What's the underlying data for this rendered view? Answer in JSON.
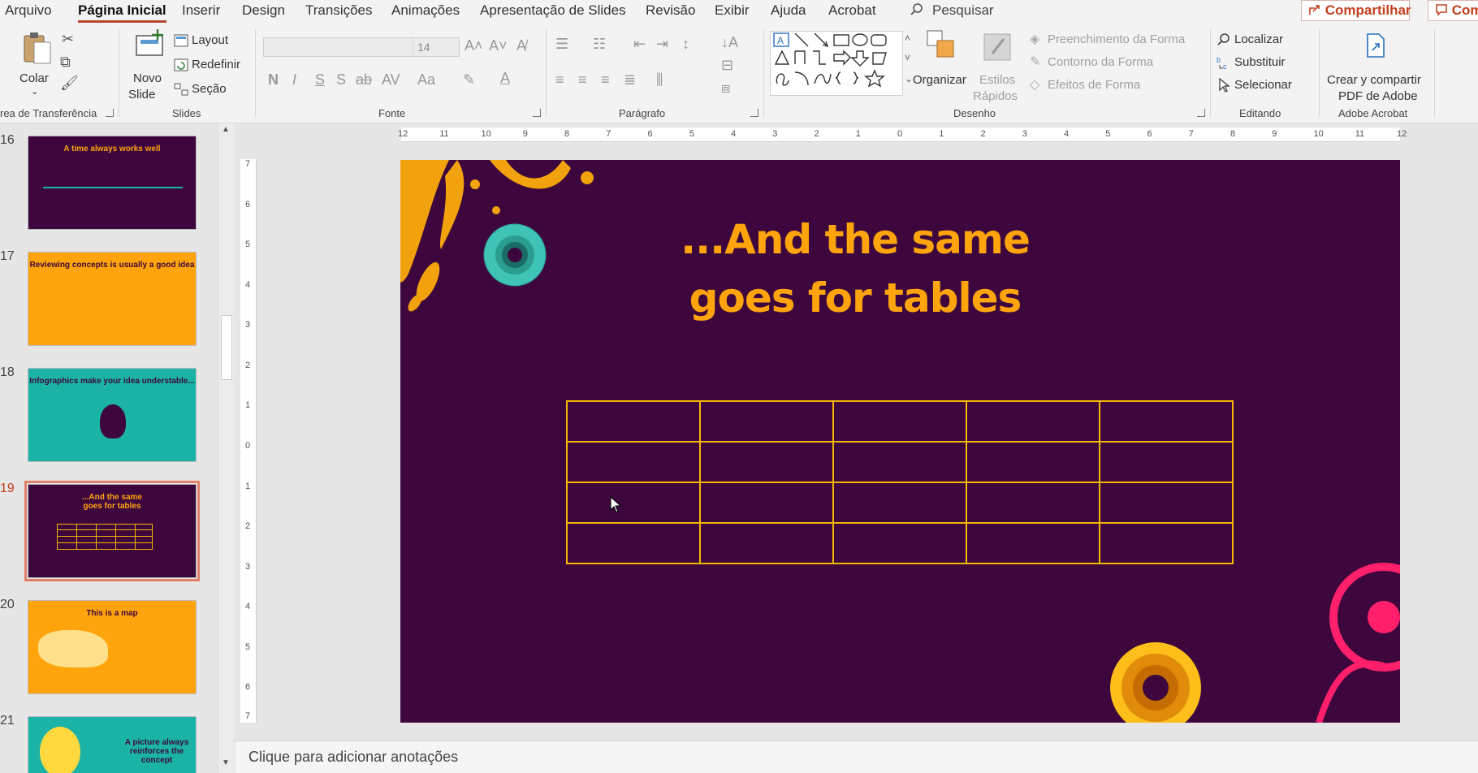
{
  "menu": {
    "tabs": [
      "Arquivo",
      "Página Inicial",
      "Inserir",
      "Design",
      "Transições",
      "Animações",
      "Apresentação de Slides",
      "Revisão",
      "Exibir",
      "Ajuda",
      "Acrobat"
    ],
    "active_tab": "Página Inicial",
    "search_label": "Pesquisar",
    "share_label": "Compartilhar",
    "comments_label": "Com"
  },
  "ribbon": {
    "clipboard": {
      "paste": "Colar",
      "label": "rea de Transferência"
    },
    "slides": {
      "new_slide_1": "Novo",
      "new_slide_2": "Slide",
      "layout": "Layout",
      "reset": "Redefinir",
      "section": "Seção",
      "label": "Slides"
    },
    "font": {
      "font_name": "",
      "font_size": "14",
      "label": "Fonte"
    },
    "paragraph": {
      "label": "Parágrafo"
    },
    "drawing": {
      "arrange": "Organizar",
      "quick_styles_1": "Estilos",
      "quick_styles_2": "Rápidos",
      "shape_fill": "Preenchimento da Forma",
      "shape_outline": "Contorno da Forma",
      "shape_effects": "Efeitos de Forma",
      "label": "Desenho"
    },
    "editing": {
      "find": "Localizar",
      "replace": "Substituir",
      "select": "Selecionar",
      "label": "Editando"
    },
    "acrobat": {
      "create_share_1": "Crear y compartir",
      "create_share_2": "PDF de Adobe",
      "label": "Adobe Acrobat"
    }
  },
  "thumbnails": [
    {
      "num": "16",
      "title": "A time always works well",
      "bg": "#3d073d",
      "fg": "#ffa40d"
    },
    {
      "num": "17",
      "title": "Reviewing concepts is usually a good idea",
      "bg": "#ffa40d",
      "fg": "#3d073d"
    },
    {
      "num": "18",
      "title": "Infographics make your idea understable...",
      "bg": "#1ab3a6",
      "fg": "#3d073d"
    },
    {
      "num": "19",
      "title": "...And the same goes for tables",
      "bg": "#3d073d",
      "fg": "#ffa40d"
    },
    {
      "num": "20",
      "title": "This is a map",
      "bg": "#ffa40d",
      "fg": "#3d073d"
    },
    {
      "num": "21",
      "title": "A picture always reinforces the concept",
      "bg": "#1ab3a6",
      "fg": "#3d073d"
    }
  ],
  "selected_thumbnail": "19",
  "slide": {
    "title_line1": "...And the same",
    "title_line2": "goes for tables",
    "table_rows": 4,
    "table_cols": 5,
    "bg_color": "#3d073d",
    "title_color": "#ffa40d",
    "table_border_color": "#f5b800"
  },
  "ruler": {
    "h_ticks": [
      "12",
      "11",
      "10",
      "9",
      "8",
      "7",
      "6",
      "5",
      "4",
      "3",
      "2",
      "1",
      "0",
      "1",
      "2",
      "3",
      "4",
      "5",
      "6",
      "7",
      "8",
      "9",
      "10",
      "11",
      "12"
    ],
    "v_ticks": [
      "7",
      "6",
      "5",
      "4",
      "3",
      "2",
      "1",
      "0",
      "1",
      "2",
      "3",
      "4",
      "5",
      "6",
      "7"
    ]
  },
  "notes_placeholder": "Clique para adicionar anotações"
}
